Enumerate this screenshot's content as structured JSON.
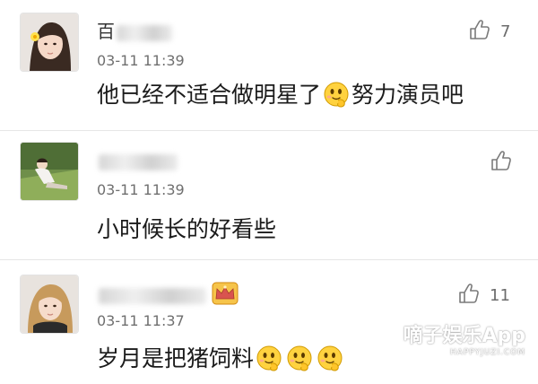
{
  "comments": [
    {
      "username_visible": "百",
      "time": "03-11 11:39",
      "text": "他已经不适合做明星了",
      "text_after_emoji": "努力演员吧",
      "likes": "7",
      "emoji_name": "smiling-face-icon"
    },
    {
      "username_visible": "",
      "time": "03-11 11:39",
      "text": "小时候长的好看些",
      "likes": ""
    },
    {
      "username_visible": "",
      "time": "03-11 11:37",
      "text": "岁月是把猪饲料",
      "likes": "11",
      "badge": "crown-icon",
      "emoji_name": "smiling-face-icon"
    }
  ],
  "watermark": {
    "main": "嘀子娱乐App",
    "sub": "HAPPYJUZI.COM"
  },
  "colors": {
    "divider": "#e6e6e6",
    "time": "#6f6f6f",
    "like": "#6c6c6c",
    "crown": "#e8a21a"
  },
  "icons": [
    "thumbs-up-icon",
    "smiling-face-icon",
    "crown-icon"
  ]
}
